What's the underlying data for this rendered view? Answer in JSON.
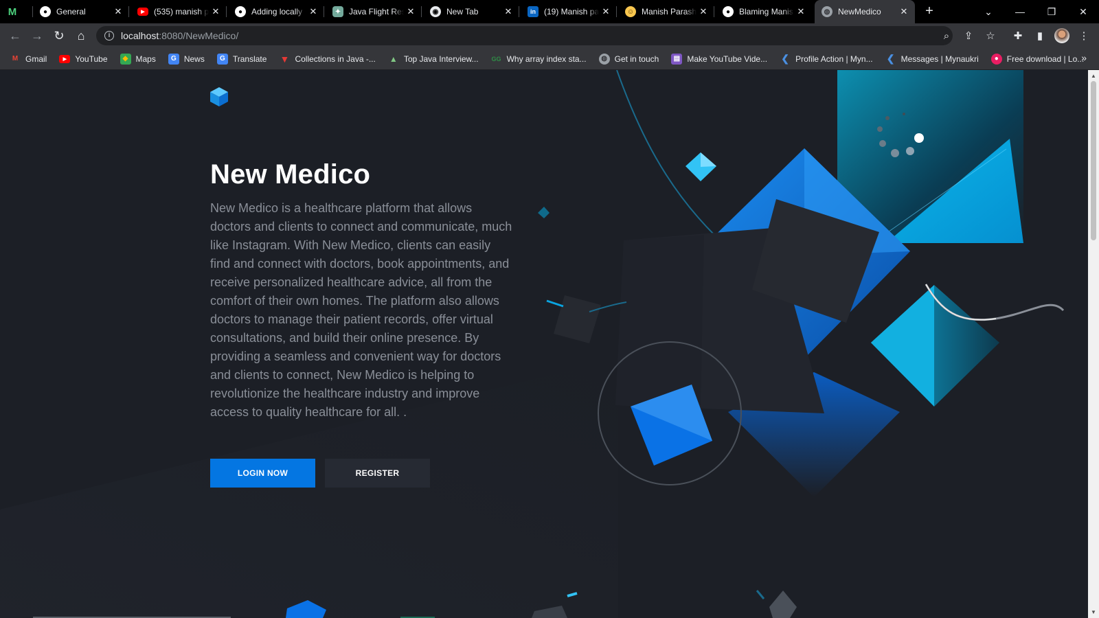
{
  "browser": {
    "tabs": [
      {
        "title": "",
        "icon": "mailchimp-icon",
        "active": false
      },
      {
        "title": "General",
        "icon": "github-icon",
        "active": false
      },
      {
        "title": "(535) manish p",
        "icon": "youtube-icon",
        "active": false
      },
      {
        "title": "Adding locally",
        "icon": "github-icon",
        "active": false
      },
      {
        "title": "Java Flight Res",
        "icon": "chatgpt-icon",
        "active": false
      },
      {
        "title": "New Tab",
        "icon": "chrome-icon",
        "active": false
      },
      {
        "title": "(19) Manish pa",
        "icon": "linkedin-icon",
        "active": false
      },
      {
        "title": "Manish Parash",
        "icon": "smiley-icon",
        "active": false
      },
      {
        "title": "Blaming Manis",
        "icon": "github-icon",
        "active": false
      },
      {
        "title": "NewMedico",
        "icon": "globe-icon",
        "active": true
      }
    ],
    "address": {
      "host": "localhost",
      "path": ":8080/NewMedico/"
    },
    "bookmarks": [
      {
        "label": "Gmail",
        "icon": "gmail-icon",
        "color": "#ea4335"
      },
      {
        "label": "YouTube",
        "icon": "youtube-icon",
        "color": "#ff0000"
      },
      {
        "label": "Maps",
        "icon": "maps-icon",
        "color": "#34a853"
      },
      {
        "label": "News",
        "icon": "news-icon",
        "color": "#4285f4"
      },
      {
        "label": "Translate",
        "icon": "translate-icon",
        "color": "#4285f4"
      },
      {
        "label": "Collections in Java -...",
        "icon": "triangle-icon",
        "color": "#e53935"
      },
      {
        "label": "Top Java Interview...",
        "icon": "mountain-icon",
        "color": "#2e7d32"
      },
      {
        "label": "Why array index sta...",
        "icon": "gfg-icon",
        "color": "#2f8d46"
      },
      {
        "label": "Get in touch",
        "icon": "globe-icon",
        "color": "#9aa0a6"
      },
      {
        "label": "Make YouTube Vide...",
        "icon": "clapper-icon",
        "color": "#7e57c2"
      },
      {
        "label": "Profile Action | Myn...",
        "icon": "mynaukri-icon",
        "color": "#4a90e2"
      },
      {
        "label": "Messages | Mynaukri",
        "icon": "mynaukri-icon",
        "color": "#4a90e2"
      },
      {
        "label": "Free download | Lo...",
        "icon": "pin-icon",
        "color": "#e91e63"
      }
    ]
  },
  "hero": {
    "title": "New Medico",
    "description": "New Medico is a healthcare platform that allows doctors and clients to connect and communicate, much like Instagram. With New Medico, clients can easily find and connect with doctors, book appointments, and receive personalized healthcare advice, all from the comfort of their own homes. The platform also allows doctors to manage their patient records, offer virtual consultations, and build their online presence. By providing a seamless and convenient way for doctors and clients to connect, New Medico is helping to revolutionize the healthcare industry and improve access to quality healthcare for all. .",
    "login_label": "LOGIN NOW",
    "register_label": "REGISTER"
  },
  "colors": {
    "accent": "#0476e2",
    "background": "#1c1f26",
    "secondary_button": "#262a33"
  }
}
